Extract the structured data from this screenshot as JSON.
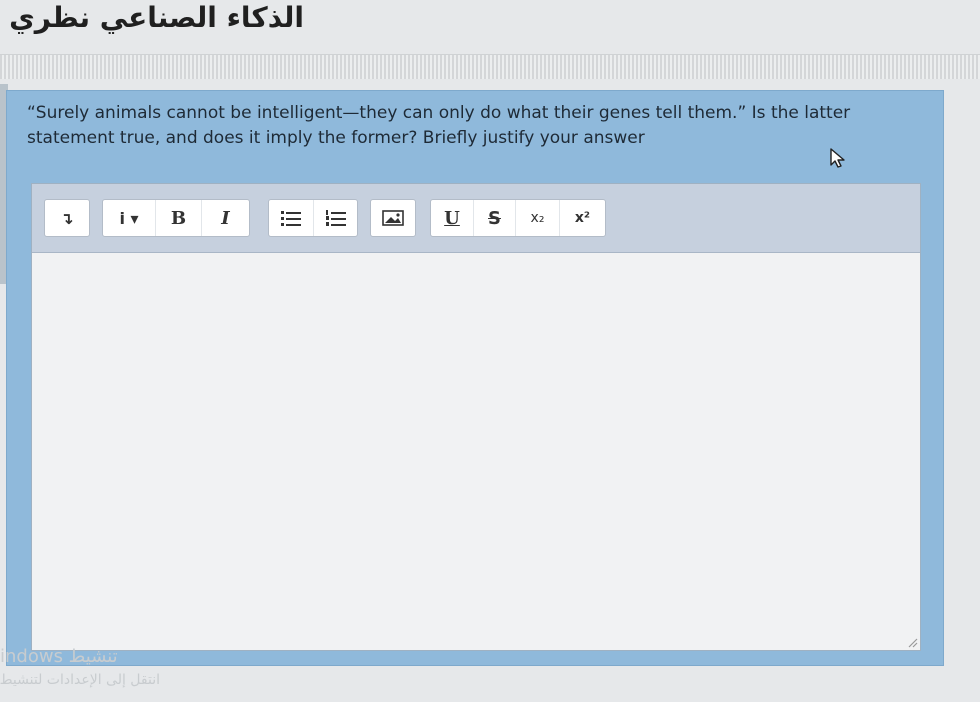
{
  "header": {
    "title": "الذكاء الصناعي نظري"
  },
  "question": {
    "text": "“Surely animals cannot be intelligent—they can only do what their genes tell them.” Is the latter statement true, and does it imply the former? Briefly justify your answer"
  },
  "editor": {
    "toolbar": {
      "expand_label": "↴",
      "info_label": "i ▾",
      "bold_label": "B",
      "italic_label": "I",
      "underline_label": "U",
      "strike_label": "S",
      "subscript_label": "x₂",
      "superscript_label": "x²"
    },
    "content": ""
  },
  "watermark": {
    "line1": "indows تنشيط",
    "line2": "انتقل إلى الإعدادات لتنشيط"
  },
  "colors": {
    "panel": "#8fb9db",
    "toolbar": "#c6d0de",
    "editor_bg": "#f1f2f3"
  }
}
